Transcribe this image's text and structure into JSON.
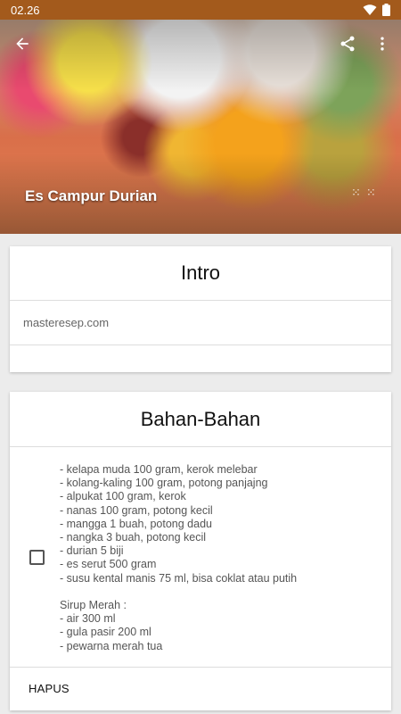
{
  "status_bar": {
    "time": "02.26",
    "icons": [
      "wifi-icon",
      "battery-icon"
    ],
    "background": "#a35a1c"
  },
  "header": {
    "title": "Es Campur Durian",
    "dots": "⁙⁙",
    "back_icon": "arrow-back-icon",
    "share_icon": "share-icon",
    "more_icon": "more-vert-icon"
  },
  "intro": {
    "heading": "Intro",
    "text": "masteresep.com"
  },
  "bahan": {
    "heading": "Bahan-Bahan",
    "checked": false,
    "ingredients": "- kelapa muda 100 gram, kerok melebar\n- kolang-kaling 100 gram, potong panjajng\n- alpukat 100 gram, kerok\n- nanas 100 gram, potong kecil\n- mangga 1 buah, potong dadu\n- nangka 3 buah, potong kecil\n- durian 5 biji\n- es serut 500 gram\n- susu kental manis 75 ml, bisa coklat atau putih\n\nSirup Merah :\n- air 300 ml\n- gula pasir 200 ml\n- pewarna merah tua",
    "action_label": "HAPUS"
  }
}
